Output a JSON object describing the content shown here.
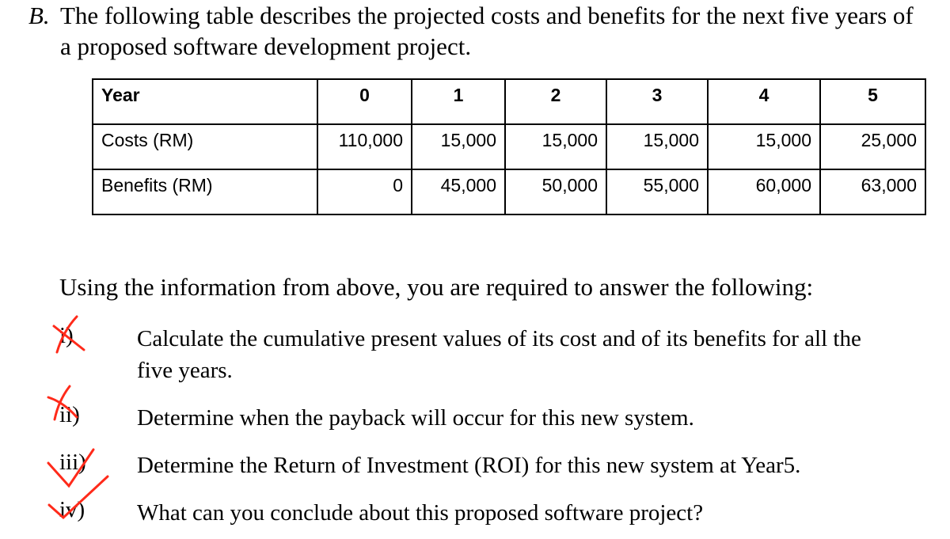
{
  "heading": {
    "label": "B.",
    "line1": "The following table describes the projected costs and benefits for the next five years of",
    "line2": "a proposed software development project."
  },
  "table": {
    "header": [
      "Year",
      "0",
      "1",
      "2",
      "3",
      "4",
      "5"
    ],
    "rows": [
      [
        "Costs (RM)",
        "110,000",
        "15,000",
        "15,000",
        "15,000",
        "15,000",
        "25,000"
      ],
      [
        "Benefits (RM)",
        "0",
        "45,000",
        "50,000",
        "55,000",
        "60,000",
        "63,000"
      ]
    ]
  },
  "intro": "Using the information from above, you are required to answer the following:",
  "questions": [
    {
      "number": "i)",
      "line1": "Calculate the cumulative present values of its cost and of its benefits for all the",
      "line2": "five years.",
      "mark": "cross"
    },
    {
      "number": "ii)",
      "line1": "Determine when the payback will occur for this new system.",
      "mark": "cross"
    },
    {
      "number": "iii)",
      "line1": "Determine the Return of Investment (ROI) for this new system at Year5.",
      "mark": "check"
    },
    {
      "number": "iv)",
      "line1": "What can you conclude about this proposed software project?",
      "mark": "check"
    }
  ],
  "colors": {
    "annotation": "#ff2a1a",
    "text": "#000000"
  }
}
